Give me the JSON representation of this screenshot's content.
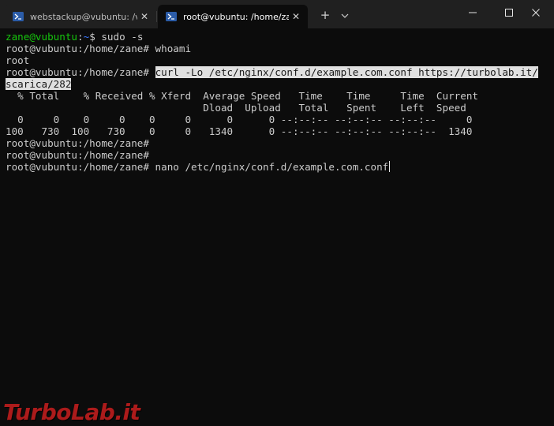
{
  "window": {
    "tabs": [
      {
        "title": "webstackup@vubuntu: /var/w",
        "close": "✕"
      },
      {
        "title": "root@vubuntu: /home/zane",
        "close": "✕"
      }
    ],
    "new_tab_label": "+",
    "dropdown_label": "⌄"
  },
  "terminal": {
    "lines": [
      {
        "user": "zane@vubuntu",
        "sep": ":",
        "path": "~",
        "rest": "$ sudo -s"
      },
      {
        "text": "root@vubuntu:/home/zane# whoami"
      },
      {
        "text": "root"
      },
      {
        "prefix": "root@vubuntu:/home/zane# ",
        "selected": "curl -Lo /etc/nginx/conf.d/example.com.conf https://turbolab.it/"
      },
      {
        "selected": "scarica/282"
      },
      {
        "text": "  % Total    % Received % Xferd  Average Speed   Time    Time     Time  Current"
      },
      {
        "text": "                                 Dload  Upload   Total   Spent    Left  Speed"
      },
      {
        "text": "  0     0    0     0    0     0      0      0 --:--:-- --:--:-- --:--:--     0"
      },
      {
        "text": "100   730  100   730    0     0   1340      0 --:--:-- --:--:-- --:--:--  1340"
      },
      {
        "text": "root@vubuntu:/home/zane#"
      },
      {
        "text": "root@vubuntu:/home/zane#"
      },
      {
        "text": "root@vubuntu:/home/zane# nano /etc/nginx/conf.d/example.com.conf"
      }
    ]
  },
  "watermark": {
    "part1": "Turbo",
    "part2": "Lab",
    "part3": ".it"
  },
  "colors": {
    "background": "#0c0c0c",
    "titlebar": "#202020",
    "prompt_green": "#16c60c",
    "prompt_blue": "#3b78ff",
    "selection": "#e0e0e0",
    "watermark_red": "#c81e1e"
  }
}
